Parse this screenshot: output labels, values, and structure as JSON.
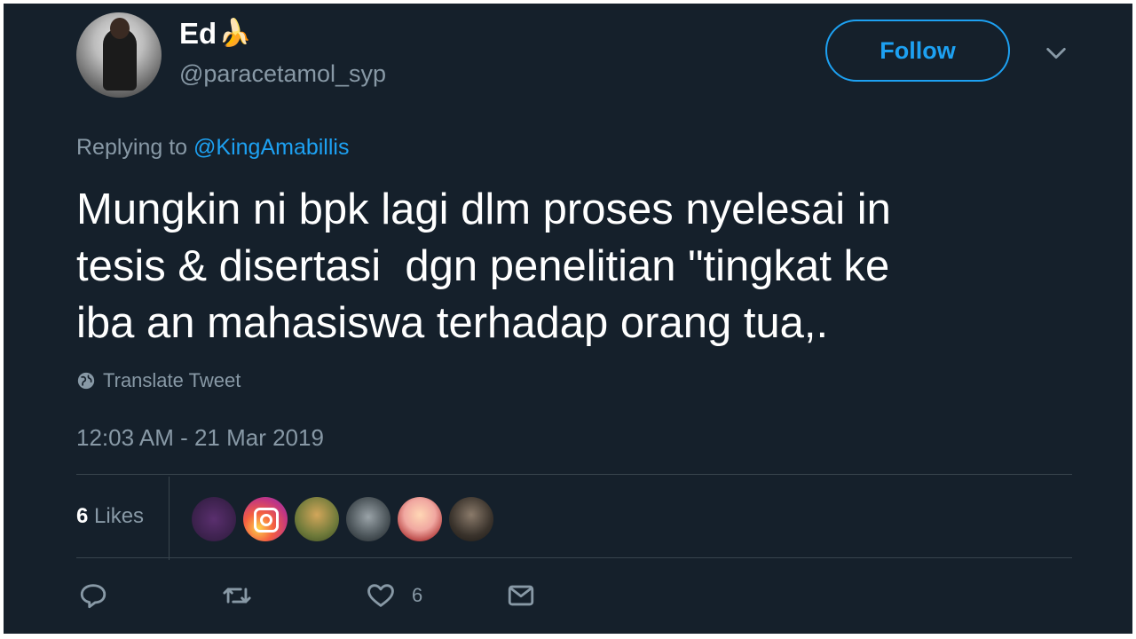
{
  "author": {
    "display_name": "Ed",
    "display_emoji": "🍌",
    "handle": "@paracetamol_syp"
  },
  "follow_button": {
    "label": "Follow"
  },
  "reply": {
    "prefix": "Replying to ",
    "mention": "@KingAmabillis"
  },
  "tweet": {
    "text": "Mungkin ni bpk lagi dlm proses nyelesai in\ntesis & disertasi  dgn penelitian \"tingkat ke\niba an mahasiswa terhadap orang tua,."
  },
  "translate": {
    "label": "Translate Tweet"
  },
  "timestamp": "12:03 AM - 21 Mar 2019",
  "likes": {
    "count": "6",
    "label": "Likes"
  },
  "actions": {
    "reply_icon": "reply-icon",
    "retweet_icon": "retweet-icon",
    "like_icon": "heart-icon",
    "like_count": "6",
    "dm_icon": "envelope-icon"
  },
  "colors": {
    "background": "#15202b",
    "accent": "#1da1f2",
    "muted": "#8899a6",
    "divider": "#38444d"
  }
}
